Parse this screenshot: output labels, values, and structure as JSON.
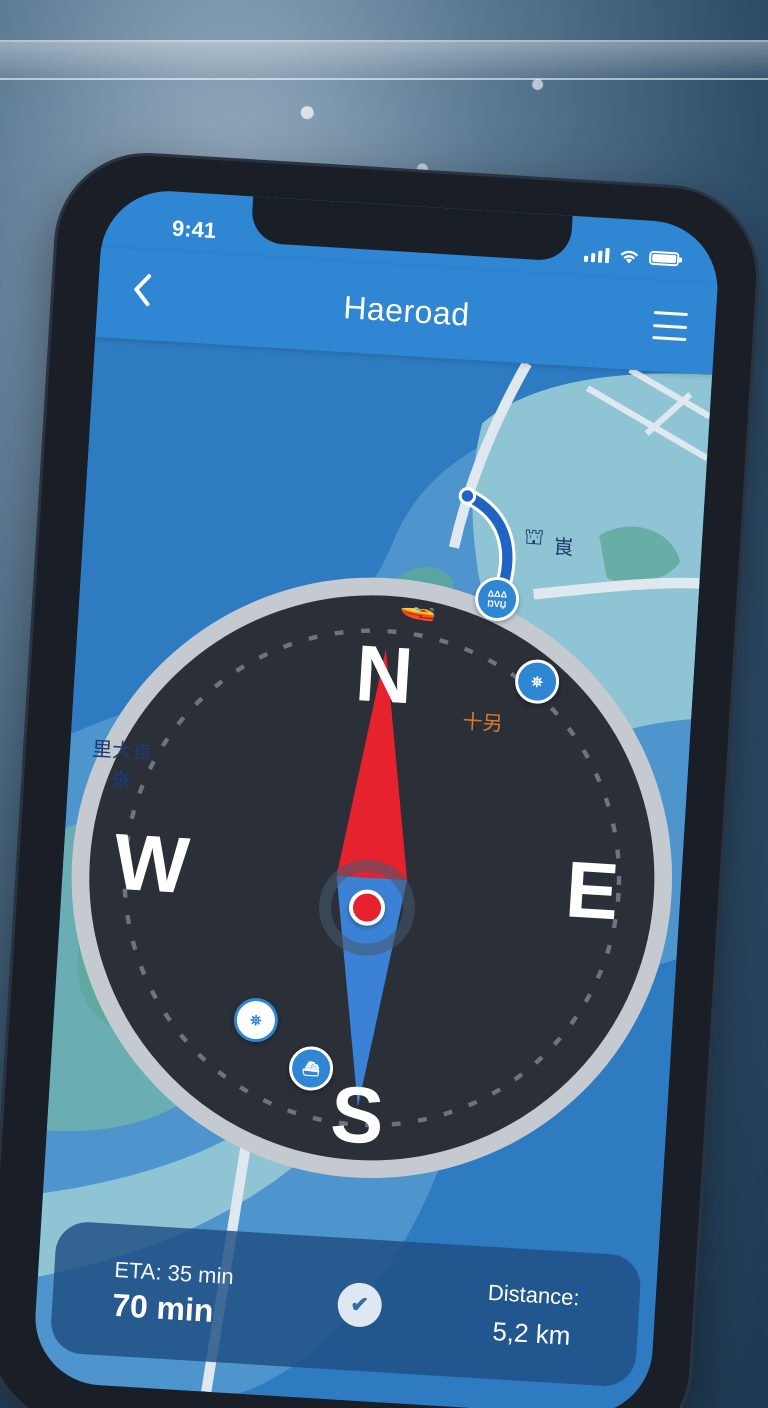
{
  "status_bar": {
    "time": "9:41"
  },
  "header": {
    "title": "Haeroad",
    "back_icon": "chevron-left-icon",
    "menu_icon": "hamburger-menu-icon"
  },
  "compass": {
    "north": "N",
    "south": "S",
    "east": "E",
    "west": "W"
  },
  "map": {
    "labels": {
      "left_place": "里大崀",
      "mid_place": "十另",
      "top_place": "崀"
    },
    "poi": {
      "top_marker": "ΔΔΔ ŊVЏ"
    }
  },
  "trip_panel": {
    "eta_label": "ETA: 35 min",
    "eta_value": "70 min",
    "distance_label": "Distance:",
    "distance_value": "5,2 km"
  },
  "colors": {
    "accent": "#2f86d3",
    "route": "#1f63c4",
    "location": "#e5222e",
    "land": "#8fc4d4"
  }
}
